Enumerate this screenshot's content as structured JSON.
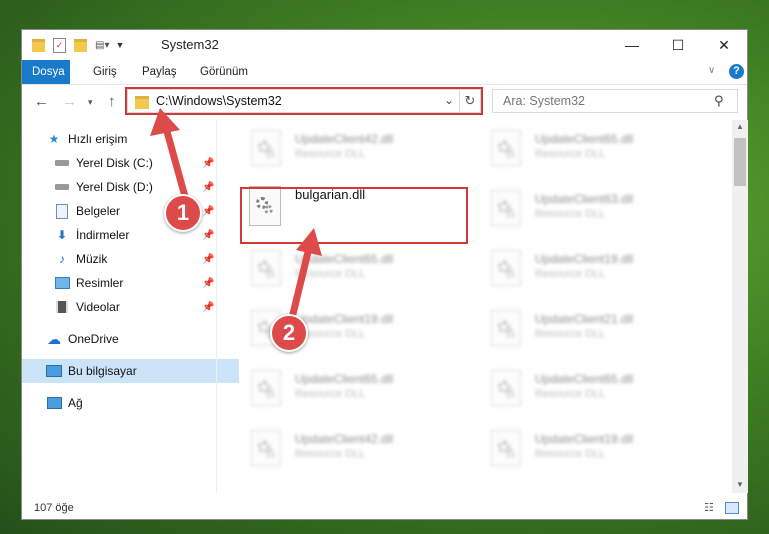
{
  "window": {
    "title": "System32",
    "controls": {
      "minimize": "—",
      "maximize": "☐",
      "close": "✕"
    }
  },
  "ribbon": {
    "tabs": [
      {
        "label": "Dosya",
        "active": true
      },
      {
        "label": "Giriş"
      },
      {
        "label": "Paylaş"
      },
      {
        "label": "Görünüm"
      }
    ]
  },
  "address": {
    "path": "C:\\Windows\\System32"
  },
  "search": {
    "placeholder": "Ara: System32"
  },
  "sidebar": {
    "items": [
      {
        "label": "Hızlı erişim",
        "icon": "star-icon"
      },
      {
        "label": "Yerel Disk (C:)",
        "icon": "drive-icon",
        "pinned": true
      },
      {
        "label": "Yerel Disk (D:)",
        "icon": "drive-icon",
        "pinned": true
      },
      {
        "label": "Belgeler",
        "icon": "documents-icon",
        "pinned": true
      },
      {
        "label": "İndirmeler",
        "icon": "download-icon",
        "pinned": true
      },
      {
        "label": "Müzik",
        "icon": "music-icon",
        "pinned": true
      },
      {
        "label": "Resimler",
        "icon": "pictures-icon",
        "pinned": true
      },
      {
        "label": "Videolar",
        "icon": "videos-icon",
        "pinned": true
      },
      {
        "label": "OneDrive",
        "icon": "cloud-icon"
      },
      {
        "label": "Bu bilgisayar",
        "icon": "computer-icon",
        "selected": true
      },
      {
        "label": "Ağ",
        "icon": "network-icon"
      }
    ]
  },
  "files": [
    {
      "name": "UpdateClient42.dll",
      "type": "Resource DLL"
    },
    {
      "name": "UpdateClient65.dll",
      "type": "Resource DLL"
    },
    {
      "name": "bulgarian.dll",
      "type": ""
    },
    {
      "name": "UpdateClient63.dll",
      "type": "Resource DLL"
    },
    {
      "name": "UpdateClient65.dll",
      "type": "Resource DLL"
    },
    {
      "name": "UpdateClient19.dll",
      "type": "Resource DLL"
    },
    {
      "name": "UpdateClient19.dll",
      "type": "Resource DLL"
    },
    {
      "name": "UpdateClient21.dll",
      "type": "Resource DLL"
    },
    {
      "name": "UpdateClient65.dll",
      "type": "Resource DLL"
    },
    {
      "name": "UpdateClient65.dll",
      "type": "Resource DLL"
    },
    {
      "name": "UpdateClient42.dll",
      "type": "Resource DLL"
    },
    {
      "name": "UpdateClient19.dll",
      "type": "Resource DLL"
    }
  ],
  "status": {
    "count": "107 öğe"
  },
  "annotations": {
    "step1": "1",
    "step2": "2"
  },
  "colors": {
    "accent": "#1979ca",
    "highlight": "#d23a3a",
    "selected": "#cce4f7"
  }
}
